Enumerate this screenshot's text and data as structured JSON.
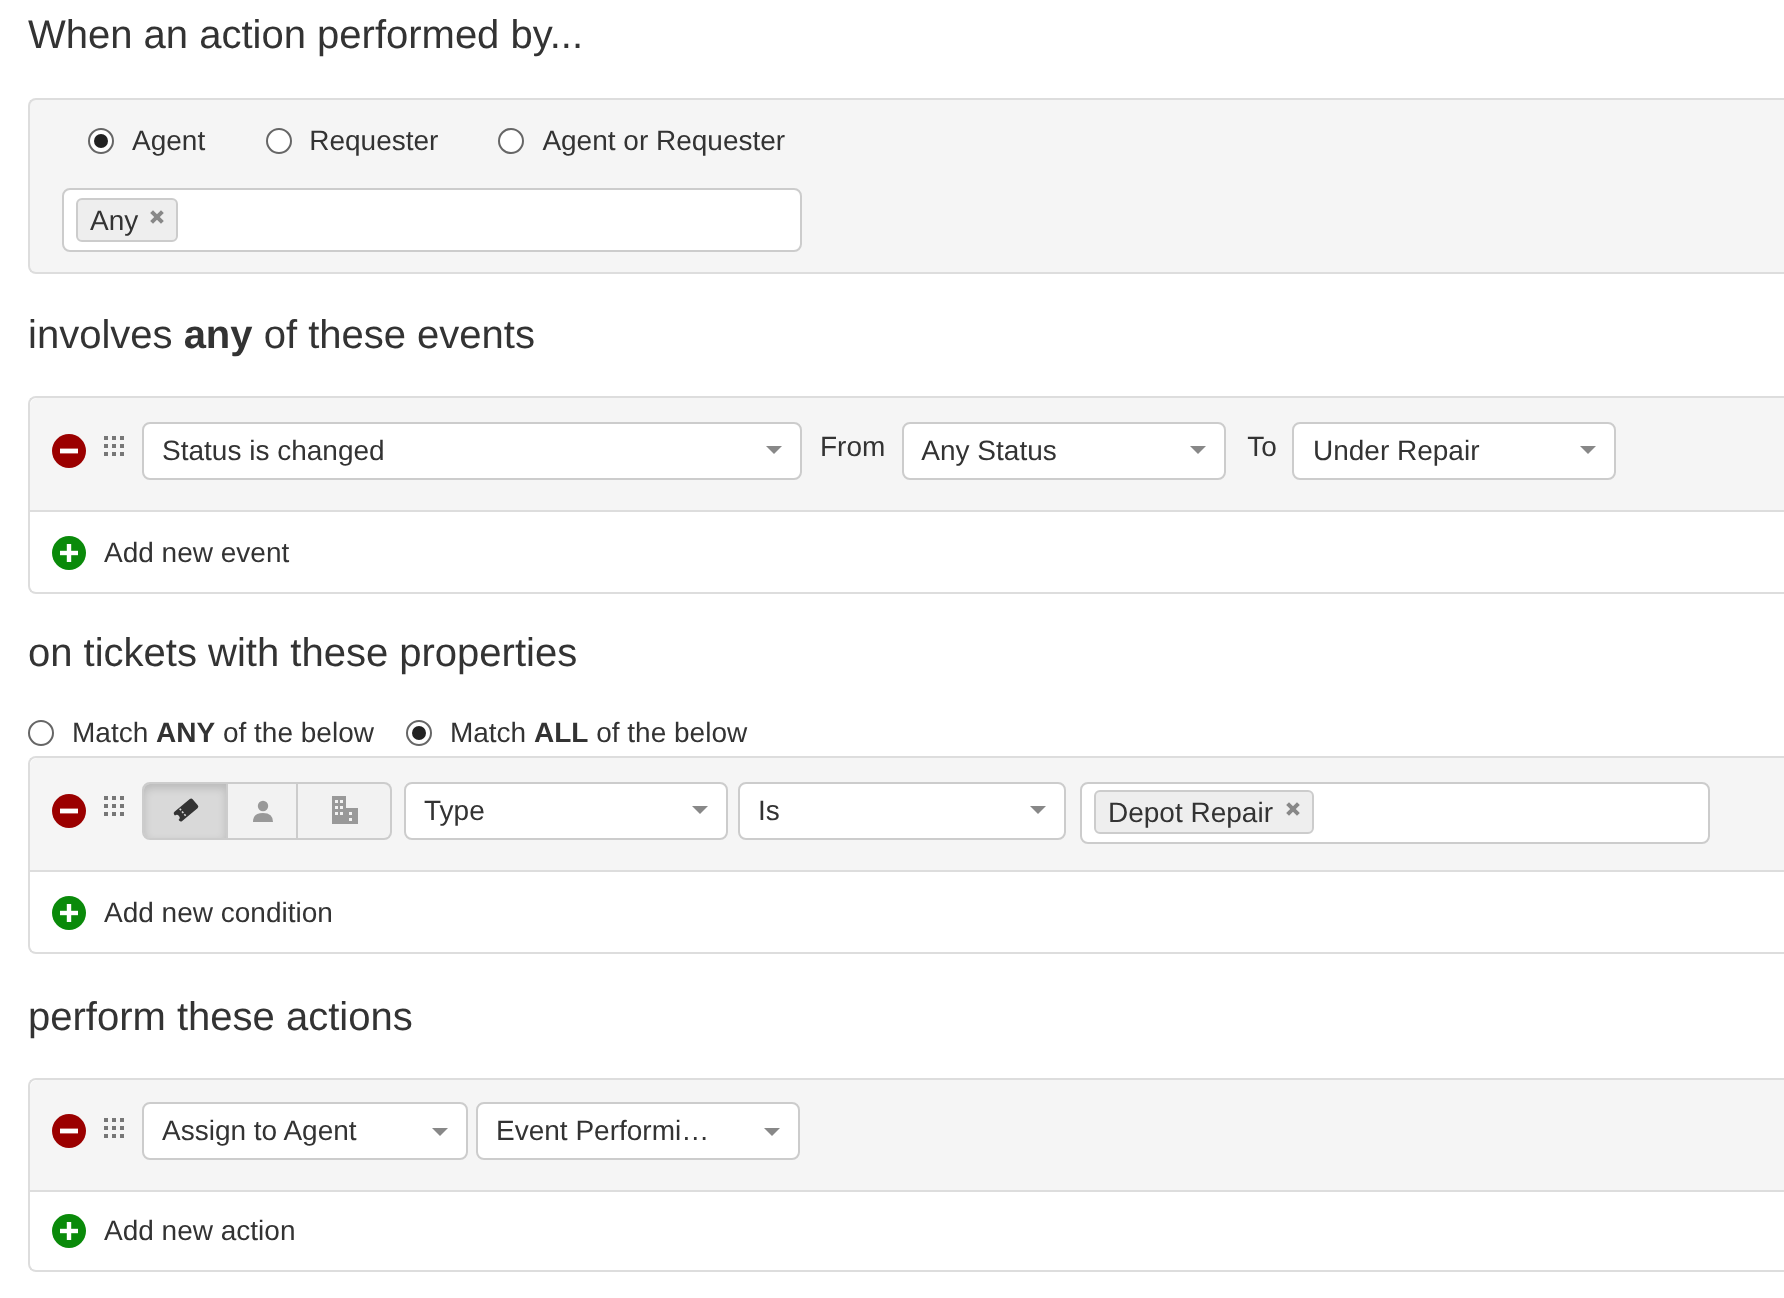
{
  "trigger": {
    "heading": "When an action performed by...",
    "performers": [
      {
        "label": "Agent",
        "selected": true
      },
      {
        "label": "Requester",
        "selected": false
      },
      {
        "label": "Agent or Requester",
        "selected": false
      }
    ],
    "tags": [
      "Any"
    ]
  },
  "events": {
    "heading": "involves **any** of these events",
    "rows": [
      {
        "event": "Status is changed",
        "from_label": "From",
        "from": "Any Status",
        "to_label": "To",
        "to": "Under Repair"
      }
    ],
    "add_label": "Add new event"
  },
  "conditions": {
    "heading": "on tickets with these properties",
    "match": [
      {
        "label": "Match **ANY** of the below",
        "selected": false
      },
      {
        "label": "Match **ALL** of the below",
        "selected": true
      }
    ],
    "rows": [
      {
        "scopes": [
          {
            "kind": "ticket",
            "selected": true
          },
          {
            "kind": "requester",
            "selected": false
          },
          {
            "kind": "company",
            "selected": false
          }
        ],
        "field": "Type",
        "operator": "Is",
        "values": [
          "Depot Repair"
        ]
      }
    ],
    "add_label": "Add new condition"
  },
  "actions": {
    "heading": "perform these actions",
    "rows": [
      {
        "action": "Assign to Agent",
        "value": "Event Performi…"
      }
    ],
    "add_label": "Add new action"
  }
}
